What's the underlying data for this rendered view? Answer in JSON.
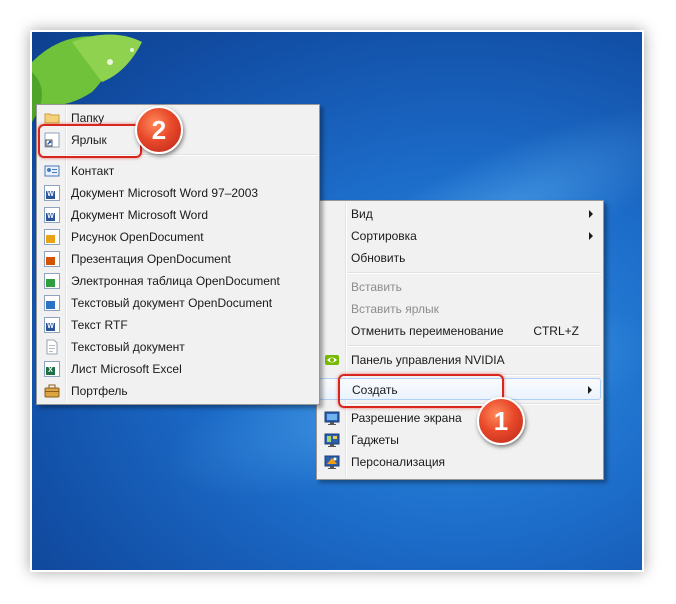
{
  "desktop_menu": {
    "items": [
      {
        "label": "Вид",
        "submenu": true
      },
      {
        "label": "Сортировка",
        "submenu": true
      },
      {
        "label": "Обновить"
      },
      {
        "label": "Вставить",
        "disabled": true
      },
      {
        "label": "Вставить ярлык",
        "disabled": true
      },
      {
        "label": "Отменить переименование",
        "shortcut": "CTRL+Z"
      },
      {
        "label": "Панель управления NVIDIA",
        "icon": "nvidia-icon"
      },
      {
        "label": "Создать",
        "submenu": true,
        "highlighted": true
      },
      {
        "label": "Разрешение экрана",
        "icon": "monitor-icon"
      },
      {
        "label": "Гаджеты",
        "icon": "gadgets-icon"
      },
      {
        "label": "Персонализация",
        "icon": "personalize-icon"
      }
    ]
  },
  "create_submenu": {
    "items": [
      {
        "label": "Папку",
        "icon": "folder-icon"
      },
      {
        "label": "Ярлык",
        "icon": "shortcut-icon",
        "highlighted": true
      },
      {
        "label": "Контакт",
        "icon": "contact-icon"
      },
      {
        "label": "Документ Microsoft Word 97–2003",
        "icon": "word-doc-icon"
      },
      {
        "label": "Документ Microsoft Word",
        "icon": "word-doc-icon"
      },
      {
        "label": "Рисунок OpenDocument",
        "icon": "odg-icon"
      },
      {
        "label": "Презентация OpenDocument",
        "icon": "odp-icon"
      },
      {
        "label": "Электронная таблица OpenDocument",
        "icon": "ods-icon"
      },
      {
        "label": "Текстовый документ OpenDocument",
        "icon": "odt-icon"
      },
      {
        "label": "Текст RTF",
        "icon": "rtf-icon"
      },
      {
        "label": "Текстовый документ",
        "icon": "txt-icon"
      },
      {
        "label": "Лист Microsoft Excel",
        "icon": "excel-icon"
      },
      {
        "label": "Портфель",
        "icon": "briefcase-icon"
      }
    ]
  },
  "annotations": {
    "step1": "1",
    "step2": "2"
  },
  "colors": {
    "annotation_red": "#d9261c",
    "desktop_blue": "#1c6cc9"
  }
}
